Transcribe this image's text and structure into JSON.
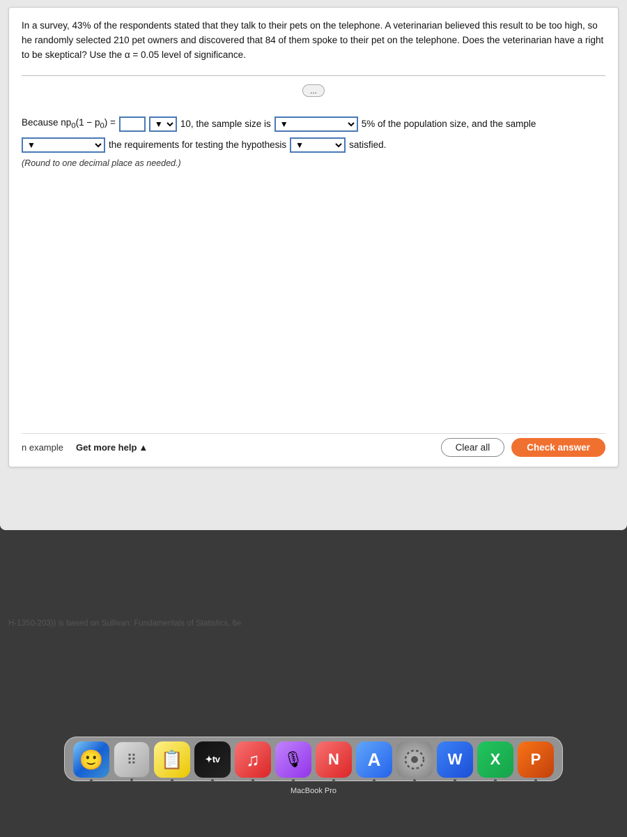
{
  "question": {
    "text": "In a survey, 43% of the respondents stated that they talk to their pets on the telephone. A veterinarian believed this result to be too high, so he randomly selected 210 pet owners and discovered that 84 of them spoke to their pet on the telephone. Does the veterinarian have a right to be skeptical? Use the α = 0.05 level of significance.",
    "formula_label": "Because np₀(1 − p₀) =",
    "input_placeholder": "",
    "dropdown1_label": "▼",
    "threshold": "10, the sample size is",
    "dropdown2_label": "▼",
    "suffix1": "5% of the population size, and the sample",
    "dropdown3_label": "▼",
    "suffix2": "the requirements for testing the hypothesis",
    "dropdown4_label": "▼",
    "suffix3": "satisfied.",
    "note": "(Round to one decimal place as needed.)"
  },
  "toolbar": {
    "more_options": "...",
    "n_example": "n example",
    "get_more_help": "Get more help",
    "chevron_up": "▲",
    "clear_all": "Clear all",
    "check_answer": "Check answer"
  },
  "footer": {
    "text": "H-1350-203)) is based on Sullivan: Fundamentals of Statistics, 6e"
  },
  "dock": {
    "label": "MacBook Pro",
    "apps": [
      {
        "name": "finder",
        "icon": "😊",
        "class": "app-finder",
        "label": "Finder"
      },
      {
        "name": "dots",
        "icon": "⠿",
        "class": "app-dots",
        "label": ""
      },
      {
        "name": "notes",
        "icon": "📝",
        "class": "app-notes",
        "label": ""
      },
      {
        "name": "tv",
        "icon": "tv",
        "class": "app-tv",
        "label": ""
      },
      {
        "name": "music",
        "icon": "♫",
        "class": "app-music",
        "label": ""
      },
      {
        "name": "podcast",
        "icon": "🎙",
        "class": "app-podcast",
        "label": ""
      },
      {
        "name": "news",
        "icon": "N",
        "class": "app-news",
        "label": ""
      },
      {
        "name": "translit",
        "icon": "A",
        "class": "app-translit",
        "label": ""
      },
      {
        "name": "system",
        "icon": "⚙",
        "class": "app-system",
        "label": ""
      },
      {
        "name": "word",
        "icon": "W",
        "class": "app-word",
        "label": ""
      },
      {
        "name": "excel",
        "icon": "X",
        "class": "app-excel",
        "label": ""
      },
      {
        "name": "ppt",
        "icon": "P",
        "class": "app-ppt",
        "label": ""
      }
    ]
  }
}
